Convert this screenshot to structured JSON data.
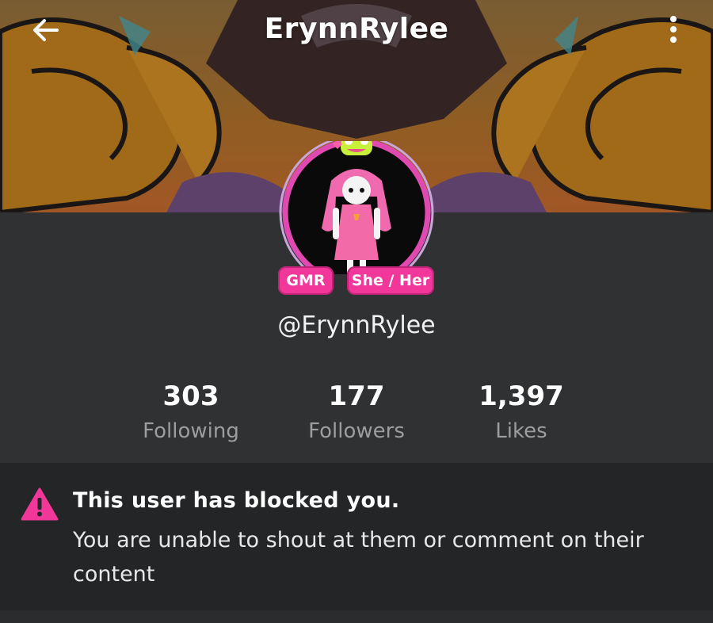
{
  "header": {
    "title": "ErynnRylee",
    "back_icon": "arrow-left-icon",
    "more_icon": "more-vertical-icon"
  },
  "profile": {
    "badges": {
      "role": "GMR",
      "pronouns": "She / Her"
    },
    "handle": "@ErynnRylee",
    "stats": {
      "following": {
        "value": "303",
        "label": "Following"
      },
      "followers": {
        "value": "177",
        "label": "Followers"
      },
      "likes": {
        "value": "1,397",
        "label": "Likes"
      }
    }
  },
  "notice": {
    "icon": "warning-icon",
    "title": "This user has blocked you.",
    "body": "You are unable to shout at them or comment on their content"
  },
  "colors": {
    "accent": "#f1379a",
    "background": "#2f3133",
    "notice_background": "#232527"
  }
}
